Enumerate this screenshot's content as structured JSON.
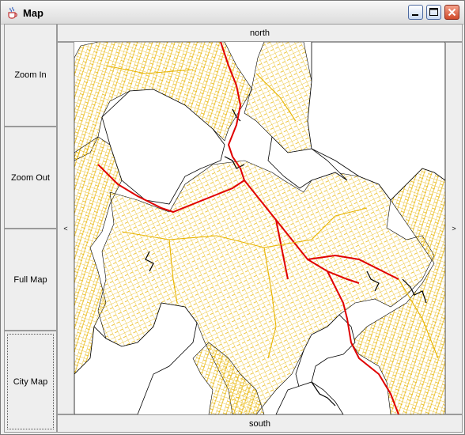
{
  "window": {
    "title": "Map"
  },
  "sidebar": {
    "zoom_in": "Zoom In",
    "zoom_out": "Zoom Out",
    "full_map": "Full Map",
    "city_map": "City Map"
  },
  "nav": {
    "north": "north",
    "south": "south",
    "west": "<",
    "east": ">"
  },
  "colors": {
    "roads": "#e8b400",
    "highways": "#e00000",
    "coastline": "#000000",
    "water": "#ffffff"
  },
  "icons": {
    "app": "java-cup-icon",
    "minimize": "minimize-icon",
    "maximize": "maximize-icon",
    "close": "close-icon"
  }
}
